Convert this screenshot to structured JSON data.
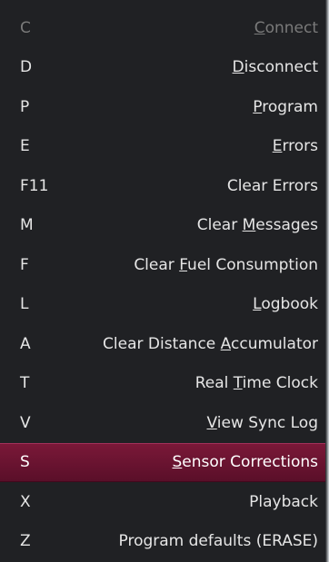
{
  "menu": {
    "items": [
      {
        "shortcut": "C",
        "pre": "",
        "key": "C",
        "post": "onnect",
        "state": "disabled"
      },
      {
        "shortcut": "D",
        "pre": "",
        "key": "D",
        "post": "isconnect",
        "state": "normal"
      },
      {
        "shortcut": "P",
        "pre": "",
        "key": "P",
        "post": "rogram",
        "state": "normal"
      },
      {
        "shortcut": "E",
        "pre": "",
        "key": "E",
        "post": "rrors",
        "state": "normal"
      },
      {
        "shortcut": "F11",
        "pre": "Clear Errors",
        "key": "",
        "post": "",
        "state": "normal"
      },
      {
        "shortcut": "M",
        "pre": "Clear ",
        "key": "M",
        "post": "essages",
        "state": "normal"
      },
      {
        "shortcut": "F",
        "pre": "Clear ",
        "key": "F",
        "post": "uel Consumption",
        "state": "normal"
      },
      {
        "shortcut": "L",
        "pre": "",
        "key": "L",
        "post": "ogbook",
        "state": "normal"
      },
      {
        "shortcut": "A",
        "pre": "Clear Distance ",
        "key": "A",
        "post": "ccumulator",
        "state": "normal"
      },
      {
        "shortcut": "T",
        "pre": "Real ",
        "key": "T",
        "post": "ime Clock",
        "state": "normal"
      },
      {
        "shortcut": "V",
        "pre": "",
        "key": "V",
        "post": "iew Sync Log",
        "state": "normal"
      },
      {
        "shortcut": "S",
        "pre": "",
        "key": "S",
        "post": "ensor Corrections",
        "state": "highlighted"
      },
      {
        "shortcut": "X",
        "pre": "Playback",
        "key": "",
        "post": "",
        "state": "normal"
      },
      {
        "shortcut": "Z",
        "pre": "Program defaults (ERASE)",
        "key": "",
        "post": "",
        "state": "normal"
      }
    ]
  },
  "colors": {
    "menu_background": "#202124",
    "text": "#e6e6e6",
    "disabled_text": "#7a7a7a",
    "highlight": "#6b1432"
  }
}
